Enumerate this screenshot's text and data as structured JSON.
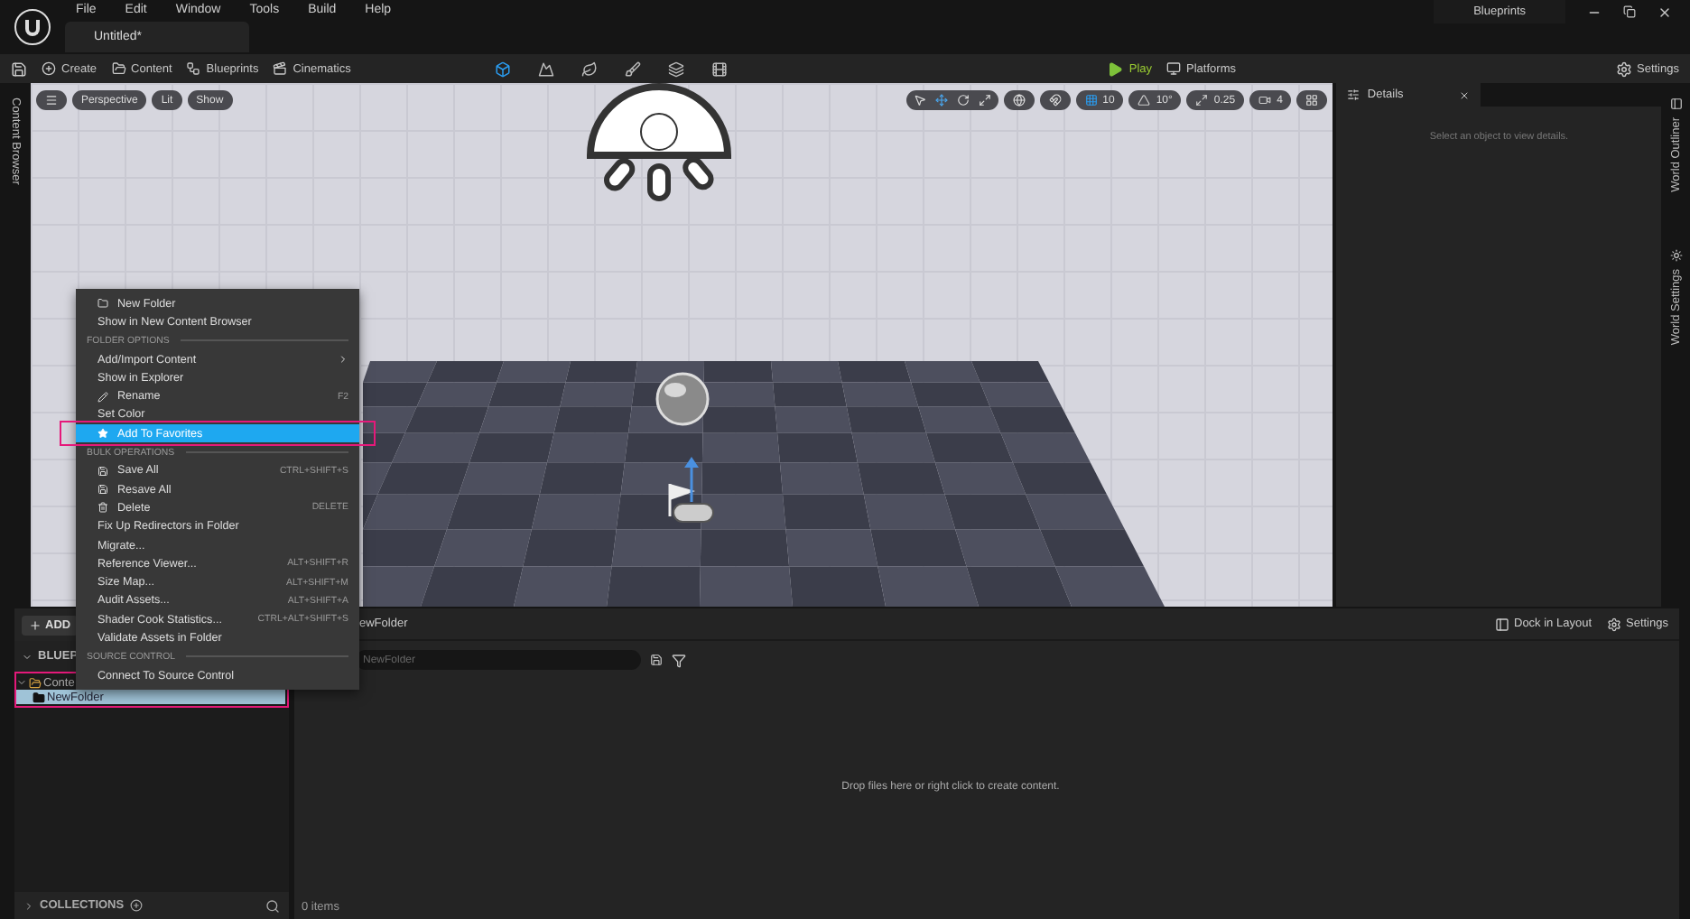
{
  "title_bar": {
    "menus": [
      "File",
      "Edit",
      "Window",
      "Tools",
      "Build",
      "Help"
    ],
    "tabs": [
      {
        "label": "Untitled*",
        "selected": true
      }
    ],
    "layout_label": "Blueprints"
  },
  "toolbar": {
    "buttons": [
      {
        "label": "Create"
      },
      {
        "label": "Content"
      },
      {
        "label": "Blueprints"
      },
      {
        "label": "Cinematics"
      }
    ],
    "modes": [
      {
        "selected": true
      },
      {
        "selected": false
      },
      {
        "selected": false
      },
      {
        "selected": false
      },
      {
        "selected": false
      },
      {
        "selected": false
      }
    ],
    "play": "Play",
    "platforms": "Platforms",
    "settings": "Settings"
  },
  "left_strip": {
    "label": "Content Browser"
  },
  "viewport": {
    "view_buttons": [
      "Perspective",
      "Lit",
      "Show"
    ],
    "snaps": [
      {
        "kind": "grid",
        "label": "10",
        "on": true
      },
      {
        "kind": "angle",
        "label": "10°",
        "on": false
      },
      {
        "kind": "scale",
        "label": "0.25",
        "on": false
      },
      {
        "kind": "camera",
        "label": "4",
        "on": false
      }
    ]
  },
  "details": {
    "tab": "Details",
    "empty_message": "Select an object to view details."
  },
  "right_strip": [
    {
      "label": "World Outliner"
    },
    {
      "label": "World Settings"
    }
  ],
  "content_browser": {
    "add": "ADD",
    "sources_header": "BLUEP",
    "tree": [
      {
        "label": "Conte",
        "expanded": true,
        "selected": false,
        "annotated": true,
        "children": [
          {
            "label": "NewFolder",
            "selected": true
          }
        ]
      }
    ],
    "collections": "COLLECTIONS",
    "path": "ewFolder",
    "search_placeholder": "NewFolder",
    "dock": "Dock in Layout",
    "settings": "Settings",
    "empty_message": "Drop files here or right click to create content.",
    "count": "0 items"
  },
  "context_menu": {
    "items": [
      {
        "kind": "item",
        "label": "New Folder",
        "selected": false
      },
      {
        "kind": "item",
        "label": "Show in New Content Browser",
        "selected": false
      },
      {
        "kind": "header",
        "label": "FOLDER OPTIONS"
      },
      {
        "kind": "item",
        "label": "Add/Import Content",
        "submenu": true,
        "selected": false
      },
      {
        "kind": "item",
        "label": "Show in Explorer",
        "selected": false
      },
      {
        "kind": "item",
        "label": "Rename",
        "shortcut": "F2",
        "selected": false
      },
      {
        "kind": "item",
        "label": "Set Color",
        "selected": false
      },
      {
        "kind": "item",
        "label": "Add To Favorites",
        "selected": true,
        "annotated": true
      },
      {
        "kind": "header",
        "label": "BULK OPERATIONS"
      },
      {
        "kind": "item",
        "label": "Save All",
        "shortcut": "CTRL+SHIFT+S",
        "selected": false
      },
      {
        "kind": "item",
        "label": "Resave All",
        "selected": false
      },
      {
        "kind": "item",
        "label": "Delete",
        "shortcut": "DELETE",
        "selected": false
      },
      {
        "kind": "item",
        "label": "Fix Up Redirectors in Folder",
        "selected": false
      },
      {
        "kind": "item",
        "label": "Migrate...",
        "selected": false
      },
      {
        "kind": "item",
        "label": "Reference Viewer...",
        "shortcut": "ALT+SHIFT+R",
        "selected": false
      },
      {
        "kind": "item",
        "label": "Size Map...",
        "shortcut": "ALT+SHIFT+M",
        "selected": false
      },
      {
        "kind": "item",
        "label": "Audit Assets...",
        "shortcut": "ALT+SHIFT+A",
        "selected": false
      },
      {
        "kind": "item",
        "label": "Shader Cook Statistics...",
        "shortcut": "CTRL+ALT+SHIFT+S",
        "selected": false
      },
      {
        "kind": "item",
        "label": "Validate Assets in Folder",
        "selected": false
      },
      {
        "kind": "header",
        "label": "SOURCE CONTROL"
      },
      {
        "kind": "item",
        "label": "Connect To Source Control",
        "selected": false
      }
    ]
  }
}
